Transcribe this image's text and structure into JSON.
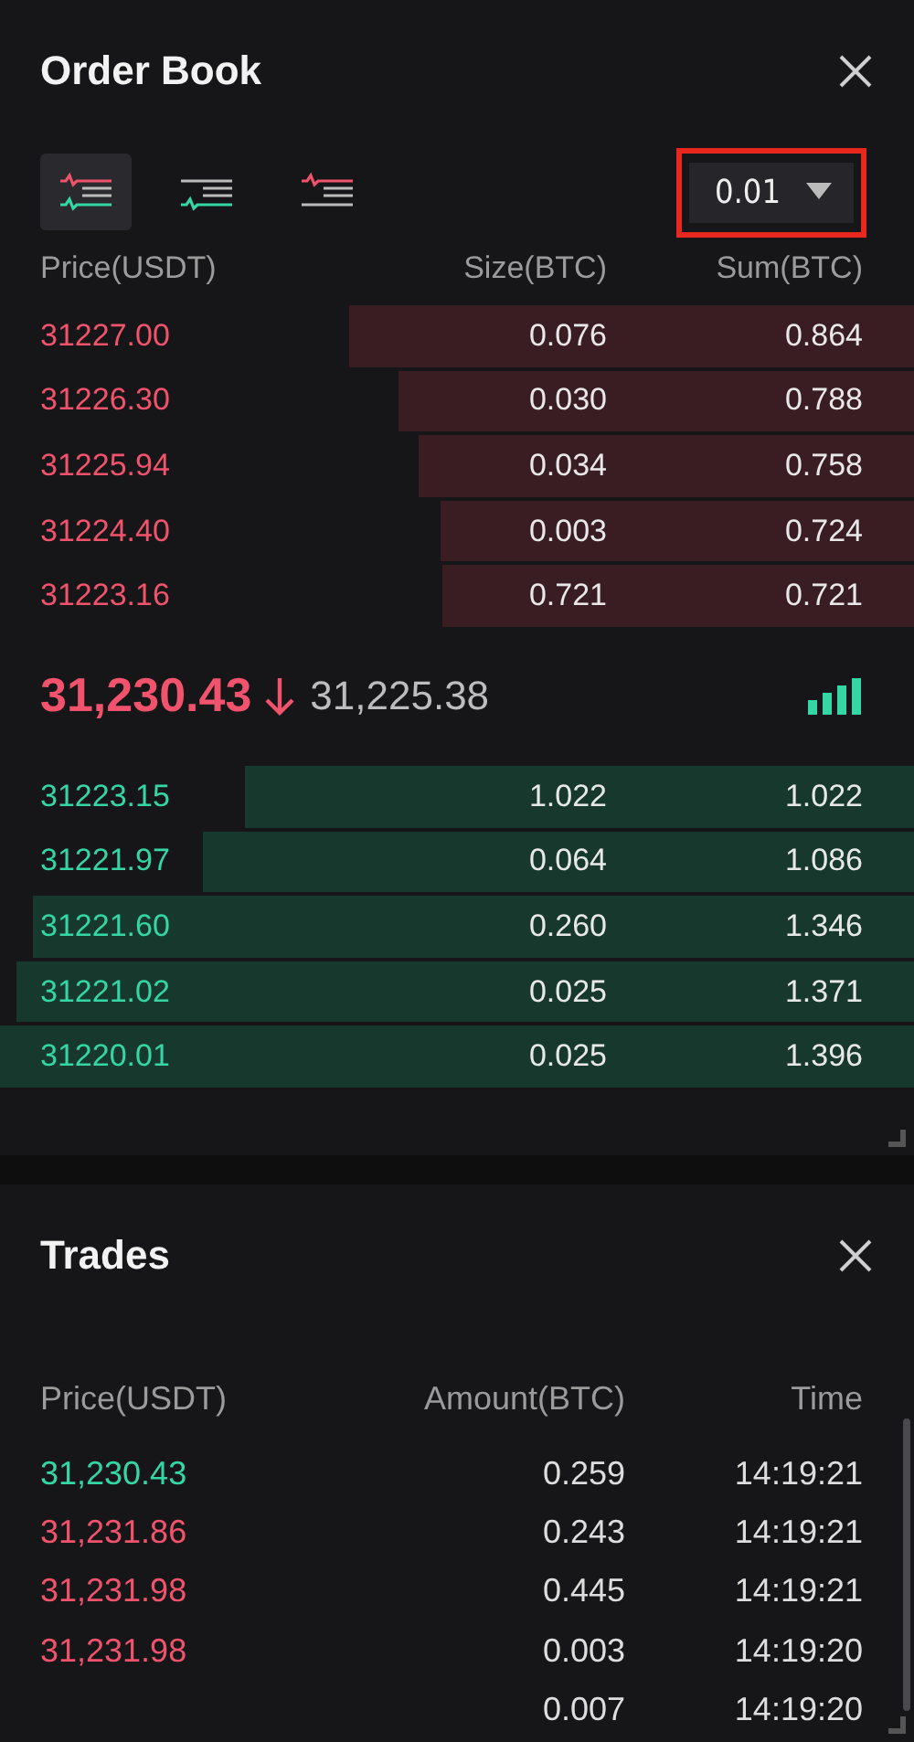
{
  "order_book": {
    "title": "Order Book",
    "view_modes": [
      {
        "kind": "both",
        "selected": true
      },
      {
        "kind": "bids",
        "selected": false
      },
      {
        "kind": "asks",
        "selected": false
      }
    ],
    "precision": {
      "value": "0.01",
      "highlighted": true
    },
    "columns": [
      "Price(USDT)",
      "Size(BTC)",
      "Sum(BTC)"
    ],
    "asks": [
      {
        "price": "31227.00",
        "size": "0.076",
        "sum": "0.864"
      },
      {
        "price": "31226.30",
        "size": "0.030",
        "sum": "0.788"
      },
      {
        "price": "31225.94",
        "size": "0.034",
        "sum": "0.758"
      },
      {
        "price": "31224.40",
        "size": "0.003",
        "sum": "0.724"
      },
      {
        "price": "31223.16",
        "size": "0.721",
        "sum": "0.721"
      }
    ],
    "last_price": {
      "price": "31,230.43",
      "mark_price": "31,225.38"
    },
    "bids": [
      {
        "price": "31223.15",
        "size": "1.022",
        "sum": "1.022"
      },
      {
        "price": "31221.97",
        "size": "0.064",
        "sum": "1.086"
      },
      {
        "price": "31221.60",
        "size": "0.260",
        "sum": "1.346"
      },
      {
        "price": "31221.02",
        "size": "0.025",
        "sum": "1.371"
      },
      {
        "price": "31220.01",
        "size": "0.025",
        "sum": "1.396"
      }
    ]
  },
  "trades": {
    "title": "Trades",
    "columns": [
      "Price(USDT)",
      "Amount(BTC)",
      "Time"
    ],
    "rows": [
      {
        "price": "31,230.43",
        "color": "#34d6a4",
        "amount": "0.259",
        "time": "14:19:21"
      },
      {
        "price": "31,231.86",
        "color": "#f0536b",
        "amount": "0.243",
        "time": "14:19:21"
      },
      {
        "price": "31,231.98",
        "color": "#f0536b",
        "amount": "0.445",
        "time": "14:19:21"
      },
      {
        "price": "31,231.98",
        "color": "#f0536b",
        "amount": "0.003",
        "time": "14:19:20"
      },
      {
        "amount": "0.007",
        "time": "14:19:20"
      }
    ]
  }
}
